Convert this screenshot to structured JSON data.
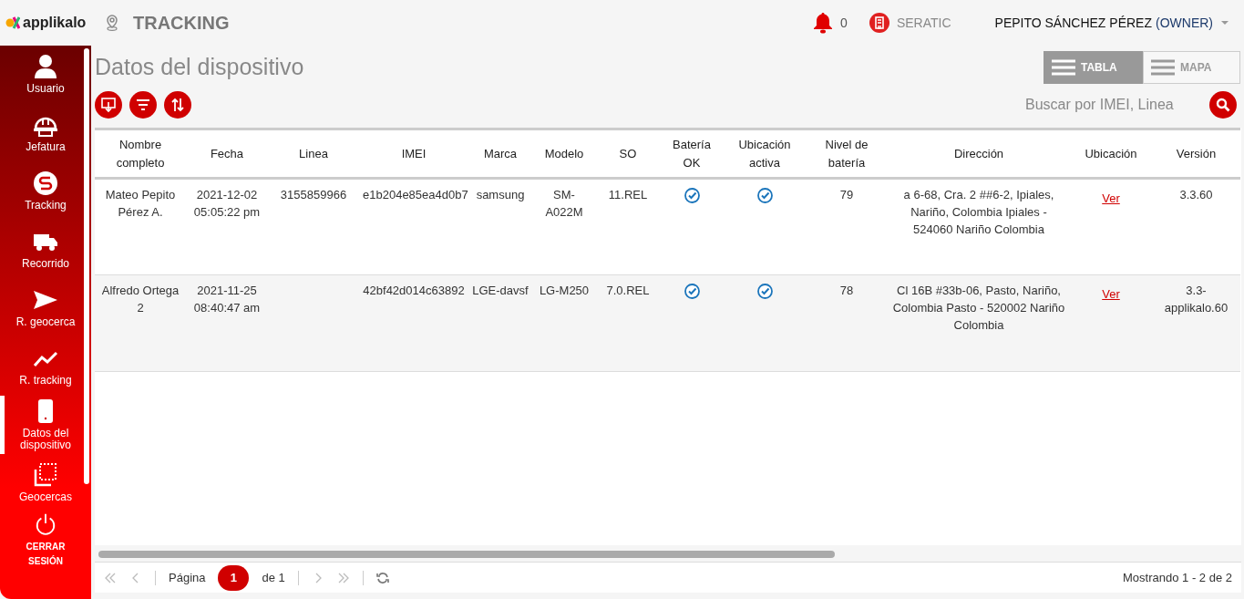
{
  "app": {
    "logo": "applikalo",
    "module": "TRACKING"
  },
  "header": {
    "notifications": "0",
    "company": "SERATIC",
    "user": "PEPITO SÁNCHEZ PÉREZ",
    "role": "(OWNER)"
  },
  "sidebar": {
    "items": [
      {
        "label": "Usuario",
        "kind": "nav",
        "selected": false
      },
      {
        "label": "Jefatura",
        "kind": "nav",
        "selected": false
      },
      {
        "label": "Tracking",
        "kind": "nav",
        "selected": false
      },
      {
        "label": "Recorrido",
        "kind": "nav",
        "selected": false
      },
      {
        "label": "R. geocerca",
        "kind": "nav",
        "selected": false
      },
      {
        "label": "R. tracking",
        "kind": "nav",
        "selected": false
      },
      {
        "label": "Datos del dispositivo",
        "kind": "nav",
        "selected": true
      },
      {
        "label": "Geocercas",
        "kind": "nav",
        "selected": false
      },
      {
        "label": "CERRAR SESIÓN",
        "kind": "logout",
        "selected": false
      }
    ]
  },
  "page": {
    "title": "Datos del dispositivo"
  },
  "view_toggle": [
    {
      "label": "TABLA",
      "selected": true
    },
    {
      "label": "MAPA",
      "selected": false
    }
  ],
  "search": {
    "placeholder": "Buscar por IMEI, Linea"
  },
  "table": {
    "columns": [
      "Nombre completo",
      "Fecha",
      "Linea",
      "IMEI",
      "Marca",
      "Modelo",
      "SO",
      "Batería OK",
      "Ubicación activa",
      "Nivel de batería",
      "Dirección",
      "Ubicación",
      "Versión"
    ],
    "rows": [
      {
        "name": "Mateo Pepito Pérez A.",
        "date": "2021-12-02 05:05:22 pm",
        "line": "3155859966",
        "imei": "e1b204e85ea4d0b7",
        "brand": "samsung",
        "model": "SM-A022M",
        "os": "11.REL",
        "battery_ok": true,
        "location_active": true,
        "battery_level": "79",
        "address": "a 6-68, Cra. 2 ##6-2, Ipiales, Nariño, Colombia Ipiales - 524060 Nariño Colombia",
        "location_link": "Ver",
        "version": "3.3.60"
      },
      {
        "name": "Alfredo Ortega 2",
        "date": "2021-11-25 08:40:47 am",
        "imei": "42bf42d014c63892",
        "brand": "LGE-davsf",
        "model": "LG-M250",
        "os": "7.0.REL",
        "battery_ok": true,
        "location_active": true,
        "battery_level": "78",
        "address": "Cl 16B #33b-06, Pasto, Nariño, Colombia Pasto - 520002 Nariño Colombia",
        "location_link": "Ver",
        "version": "3.3-applikalo.60"
      }
    ]
  },
  "pagination": {
    "page_label": "Página",
    "current_page": "1",
    "of_label": "de 1",
    "summary": "Mostrando 1 - 2 de 2"
  }
}
